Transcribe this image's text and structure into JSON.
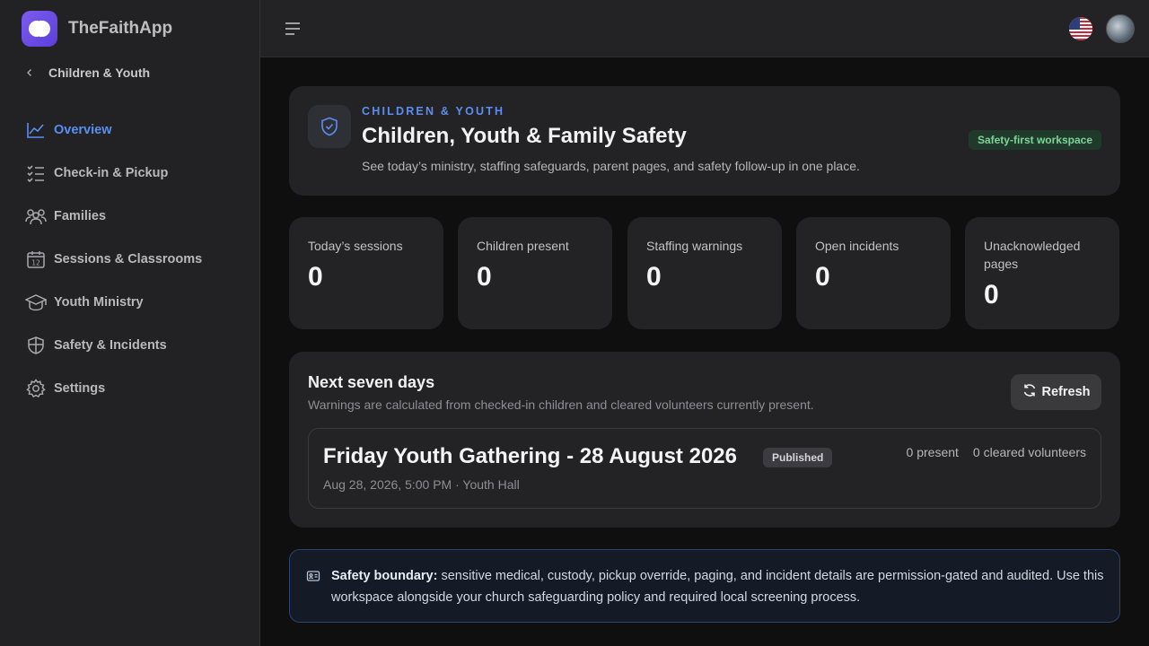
{
  "app": {
    "name": "TheFaithApp"
  },
  "sidebar": {
    "back_label": "Children & Youth",
    "items": [
      {
        "label": "Overview",
        "icon": "chart-line-icon",
        "active": true
      },
      {
        "label": "Check-in & Pickup",
        "icon": "checklist-icon",
        "active": false
      },
      {
        "label": "Families",
        "icon": "users-icon",
        "active": false
      },
      {
        "label": "Sessions & Classrooms",
        "icon": "calendar-icon",
        "active": false
      },
      {
        "label": "Youth Ministry",
        "icon": "graduation-cap-icon",
        "active": false
      },
      {
        "label": "Safety & Incidents",
        "icon": "shield-icon",
        "active": false
      },
      {
        "label": "Settings",
        "icon": "gear-icon",
        "active": false
      }
    ]
  },
  "topbar": {
    "language_flag": "us-flag-icon"
  },
  "hero": {
    "eyebrow": "CHILDREN & YOUTH",
    "title": "Children, Youth & Family Safety",
    "subtitle": "See today’s ministry, staffing safeguards, parent pages, and safety follow-up in one place.",
    "badge": "Safety-first workspace"
  },
  "stats": [
    {
      "label": "Today’s sessions",
      "value": "0"
    },
    {
      "label": "Children present",
      "value": "0"
    },
    {
      "label": "Staffing warnings",
      "value": "0"
    },
    {
      "label": "Open incidents",
      "value": "0"
    },
    {
      "label": "Unacknowledged pages",
      "value": "0"
    }
  ],
  "week": {
    "title": "Next seven days",
    "subtitle": "Warnings are calculated from checked-in children and cleared volunteers currently present.",
    "refresh_label": "Refresh",
    "session": {
      "title": "Friday Youth Gathering - 28 August 2026",
      "status": "Published",
      "meta": "Aug 28, 2026, 5:00 PM · Youth Hall",
      "present": "0 present",
      "volunteers": "0 cleared volunteers"
    }
  },
  "alert": {
    "strong": "Safety boundary:",
    "text": " sensitive medical, custody, pickup override, paging, and incident details are permission-gated and audited. Use this workspace alongside your church safeguarding policy and required local screening process."
  },
  "colors": {
    "accent": "#5b8ef0",
    "brand": "#6d4ee6",
    "success": "#7fd49a"
  }
}
